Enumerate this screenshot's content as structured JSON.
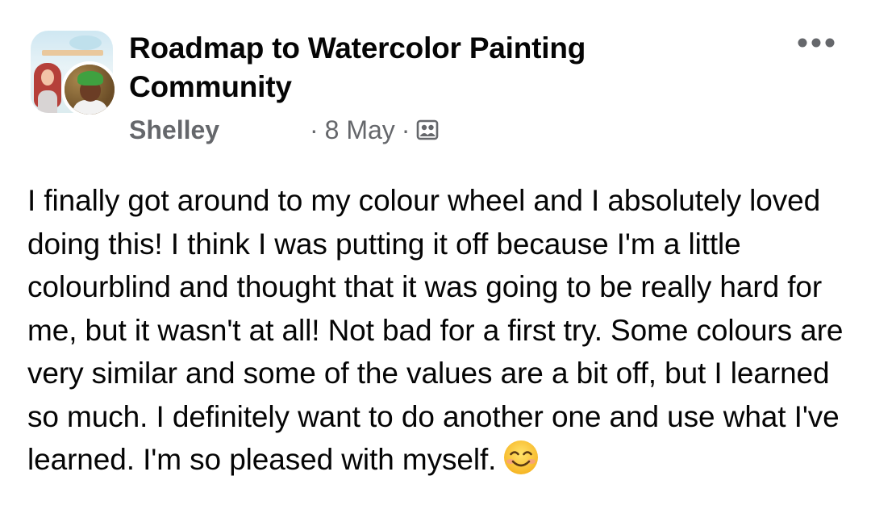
{
  "post": {
    "group_name": "Roadmap to Watercolor Painting Community",
    "author": "Shelley",
    "dot": "·",
    "date": "8 May",
    "privacy_icon": "group-members-icon",
    "more_icon": "more-options-icon",
    "text": "I finally got around to my colour wheel and I absolutely loved doing this! I think I was putting it off because I'm a little colourblind and thought that it was going to be really hard for me, but it wasn't at all! Not bad for a first try. Some colours are very similar and some of the values are a bit off, but I learned so much. I definitely want to do another one and use what I've learned. I'm so pleased with myself.",
    "emoji": "smiling-face-icon"
  },
  "colors": {
    "primary_text": "#050505",
    "secondary_text": "#65676b",
    "background": "#ffffff"
  }
}
